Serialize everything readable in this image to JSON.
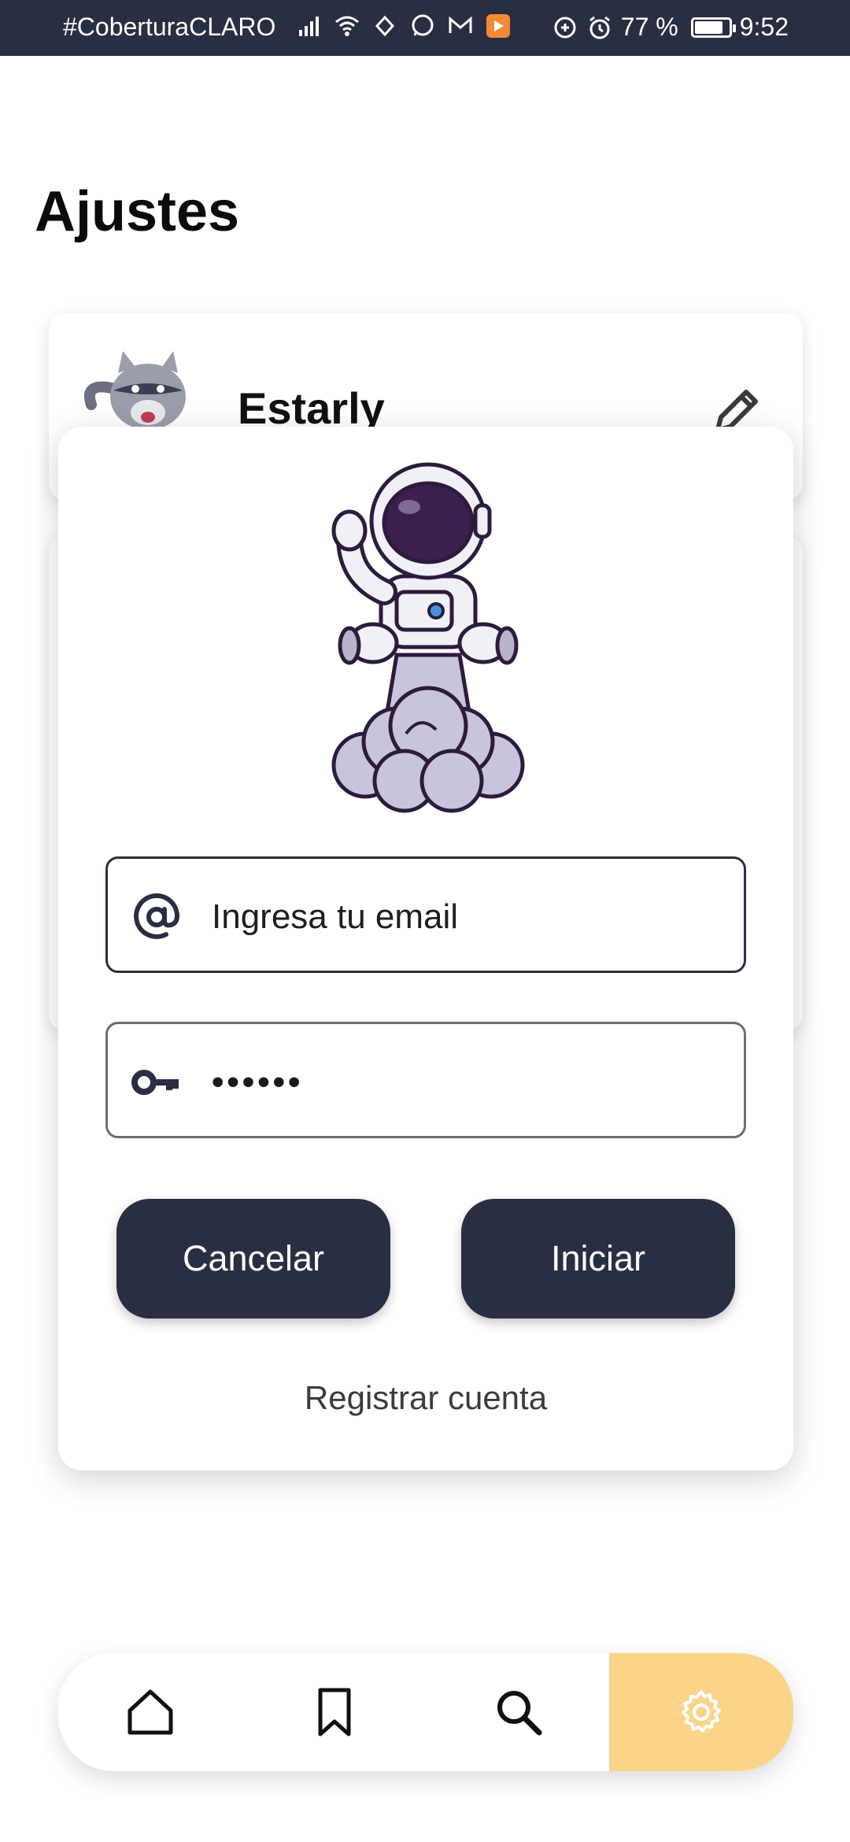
{
  "status_bar": {
    "carrier": "#CoberturaCLARO",
    "battery_percent": "77 %",
    "battery_level": 0.77,
    "time": "9:52"
  },
  "page": {
    "title": "Ajustes"
  },
  "profile": {
    "username": "Estarly"
  },
  "login_dialog": {
    "email_placeholder": "Ingresa tu email",
    "email_value": "",
    "password_value": "••••••",
    "cancel_label": "Cancelar",
    "login_label": "Iniciar",
    "register_label": "Registrar cuenta"
  },
  "bottom_nav": {
    "items": [
      {
        "icon": "home-icon",
        "active": false
      },
      {
        "icon": "bookmark-icon",
        "active": false
      },
      {
        "icon": "search-icon",
        "active": false
      },
      {
        "icon": "gear-icon",
        "active": true
      }
    ],
    "active_color": "#fbd48a"
  },
  "colors": {
    "primary": "#2a2e42",
    "accent": "#fbd48a"
  }
}
